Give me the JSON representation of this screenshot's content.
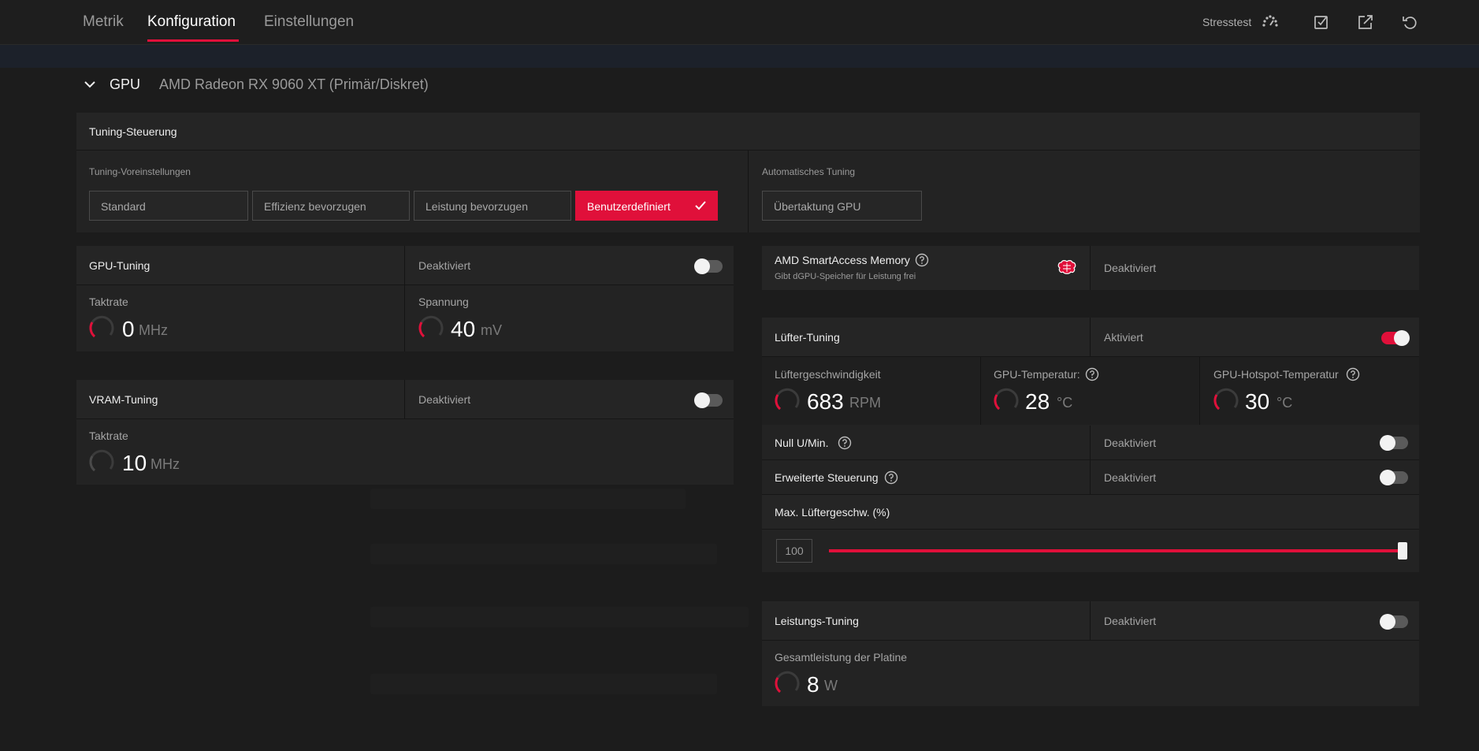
{
  "tabs": [
    {
      "label": "Metrik"
    },
    {
      "label": "Konfiguration"
    },
    {
      "label": "Einstellungen"
    }
  ],
  "toolbar": {
    "stresstest_label": "Stresstest",
    "icons": [
      "stresstest-gauge-icon",
      "import-icon",
      "export-icon",
      "reset-icon"
    ]
  },
  "gpu": {
    "label": "GPU",
    "name": "AMD Radeon RX 9060 XT (Primär/Diskret)"
  },
  "tuning_control": {
    "title": "Tuning-Steuerung",
    "presets_label": "Tuning-Voreinstellungen",
    "presets": [
      {
        "label": "Standard"
      },
      {
        "label": "Effizienz bevorzugen"
      },
      {
        "label": "Leistung bevorzugen"
      },
      {
        "label": "Benutzerdefiniert"
      }
    ],
    "selected_preset": "Benutzerdefiniert",
    "auto_label": "Automatisches Tuning",
    "auto_option": "Übertaktung GPU"
  },
  "gpu_tuning": {
    "title": "GPU-Tuning",
    "status": "Deaktiviert",
    "enabled": false,
    "clock": {
      "label": "Taktrate",
      "value": "0",
      "unit": "MHz"
    },
    "voltage": {
      "label": "Spannung",
      "value": "40",
      "unit": "mV"
    }
  },
  "vram_tuning": {
    "title": "VRAM-Tuning",
    "status": "Deaktiviert",
    "enabled": false,
    "clock": {
      "label": "Taktrate",
      "value": "10",
      "unit": "MHz"
    }
  },
  "smart_access": {
    "title": "AMD SmartAccess Memory",
    "subtitle": "Gibt dGPU-Speicher für Leistung frei",
    "status": "Deaktiviert"
  },
  "fan_tuning": {
    "title": "Lüfter-Tuning",
    "status": "Aktiviert",
    "enabled": true,
    "fan_speed": {
      "label": "Lüftergeschwindigkeit",
      "value": "683",
      "unit": "RPM"
    },
    "gpu_temp": {
      "label": "GPU-Temperatur:",
      "value": "28",
      "unit": "°C"
    },
    "hotspot_temp": {
      "label": "GPU-Hotspot-Temperatur",
      "value": "30",
      "unit": "°C"
    },
    "zero_rpm": {
      "label": "Null U/Min.",
      "status": "Deaktiviert",
      "enabled": false
    },
    "advanced": {
      "label": "Erweiterte Steuerung",
      "status": "Deaktiviert",
      "enabled": false
    },
    "max_speed": {
      "label": "Max. Lüftergeschw. (%)",
      "value": "100",
      "fraction": 1.0
    }
  },
  "power_tuning": {
    "title": "Leistungs-Tuning",
    "status": "Deaktiviert",
    "enabled": false,
    "board_power": {
      "label": "Gesamtleistung der Platine",
      "value": "8",
      "unit": "W"
    }
  },
  "colors": {
    "accent": "#e0103a",
    "background": "#1a1a1a",
    "panel": "#232323"
  }
}
